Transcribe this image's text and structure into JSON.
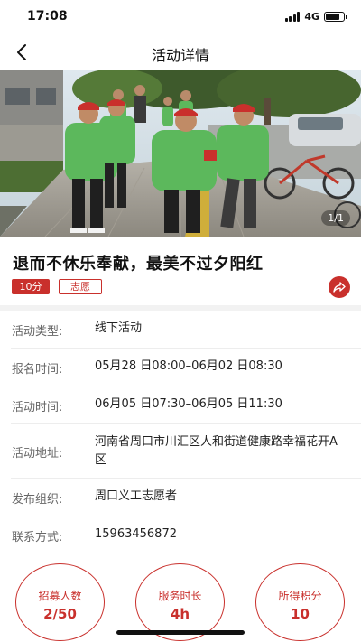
{
  "status_bar": {
    "time": "17:08",
    "network": "4G",
    "battery_level": 0.8
  },
  "nav": {
    "title": "活动详情",
    "back_icon": "chevron-left-icon"
  },
  "banner": {
    "page_indicator": "1/1"
  },
  "activity": {
    "title": "退而不休乐奉献，最美不过夕阳红",
    "points_tag": "10分",
    "category_tag": "志愿",
    "share_icon": "share-arrow-icon"
  },
  "details": [
    {
      "label": "活动类型:",
      "value": "线下活动"
    },
    {
      "label": "报名时间:",
      "value": "05月28 日08:00–06月02 日08:30"
    },
    {
      "label": "活动时间:",
      "value": "06月05 日07:30–06月05 日11:30"
    },
    {
      "label": "活动地址:",
      "value": "河南省周口市川汇区人和街道健康路幸福花开A区"
    },
    {
      "label": "发布组织:",
      "value": "周口义工志愿者"
    },
    {
      "label": "联系方式:",
      "value": "15963456872"
    }
  ],
  "stats": [
    {
      "label": "招募人数",
      "value": "2/50"
    },
    {
      "label": "服务时长",
      "value": "4h"
    },
    {
      "label": "所得积分",
      "value": "10"
    }
  ],
  "colors": {
    "accent": "#c9302c",
    "vest_green": "#5cb85c"
  }
}
